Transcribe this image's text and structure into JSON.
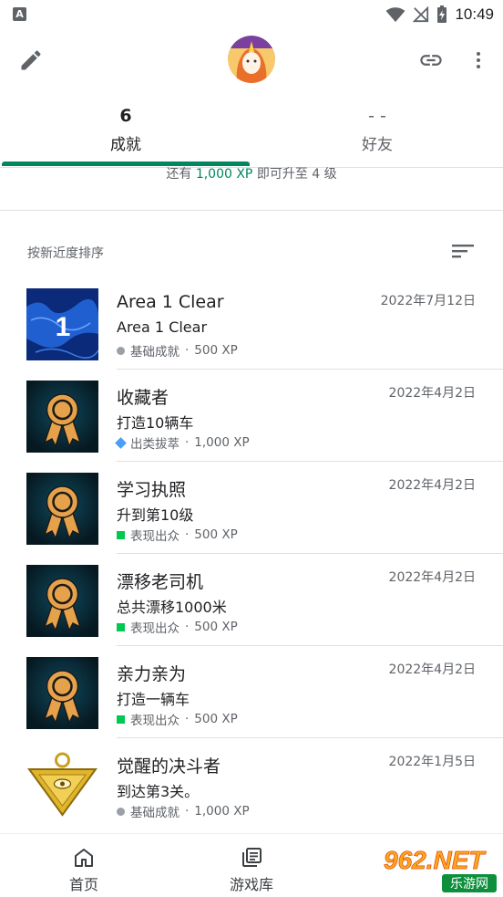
{
  "status_bar": {
    "time": "10:49",
    "notification_icon": "A"
  },
  "toolbar": {
    "edit_icon": "pencil-icon",
    "link_icon": "link-icon",
    "more_icon": "more-vert-icon"
  },
  "tabs": [
    {
      "count": "6",
      "label": "成就",
      "selected": true
    },
    {
      "count": "- -",
      "label": "好友",
      "selected": false
    }
  ],
  "xp_progress": {
    "prefix": "还有 ",
    "amount": "1,000 XP",
    "suffix": " 即可升至 4 级"
  },
  "sort": {
    "label": "按新近度排序"
  },
  "achievements": [
    {
      "title": "Area 1 Clear",
      "desc": "Area 1 Clear",
      "rarity": "基础成就",
      "xp": "500 XP",
      "date": "2022年7月12日",
      "marker": "circle",
      "icon": "area-map"
    },
    {
      "title": "收藏者",
      "desc": "打造10辆车",
      "rarity": "出类拔萃",
      "xp": "1,000 XP",
      "date": "2022年4月2日",
      "marker": "diamond",
      "icon": "medal"
    },
    {
      "title": "学习执照",
      "desc": "升到第10级",
      "rarity": "表现出众",
      "xp": "500 XP",
      "date": "2022年4月2日",
      "marker": "square",
      "icon": "medal"
    },
    {
      "title": "漂移老司机",
      "desc": "总共漂移1000米",
      "rarity": "表现出众",
      "xp": "500 XP",
      "date": "2022年4月2日",
      "marker": "square",
      "icon": "medal"
    },
    {
      "title": "亲力亲为",
      "desc": "打造一辆车",
      "rarity": "表现出众",
      "xp": "500 XP",
      "date": "2022年4月2日",
      "marker": "square",
      "icon": "medal"
    },
    {
      "title": "觉醒的决斗者",
      "desc": "到达第3关。",
      "rarity": "基础成就",
      "xp": "1,000 XP",
      "date": "2022年1月5日",
      "marker": "circle",
      "icon": "millennium-puzzle"
    }
  ],
  "bottom_nav": [
    {
      "label": "首页",
      "icon": "home-icon"
    },
    {
      "label": "游戏库",
      "icon": "library-icon"
    }
  ],
  "watermark": {
    "text": "962.NET",
    "subtext": "乐游网"
  },
  "colors": {
    "accent": "#01875f",
    "rarity_common": "#9aa0a6",
    "rarity_rare": "#4a9ff5",
    "rarity_uncommon": "#00c853"
  }
}
